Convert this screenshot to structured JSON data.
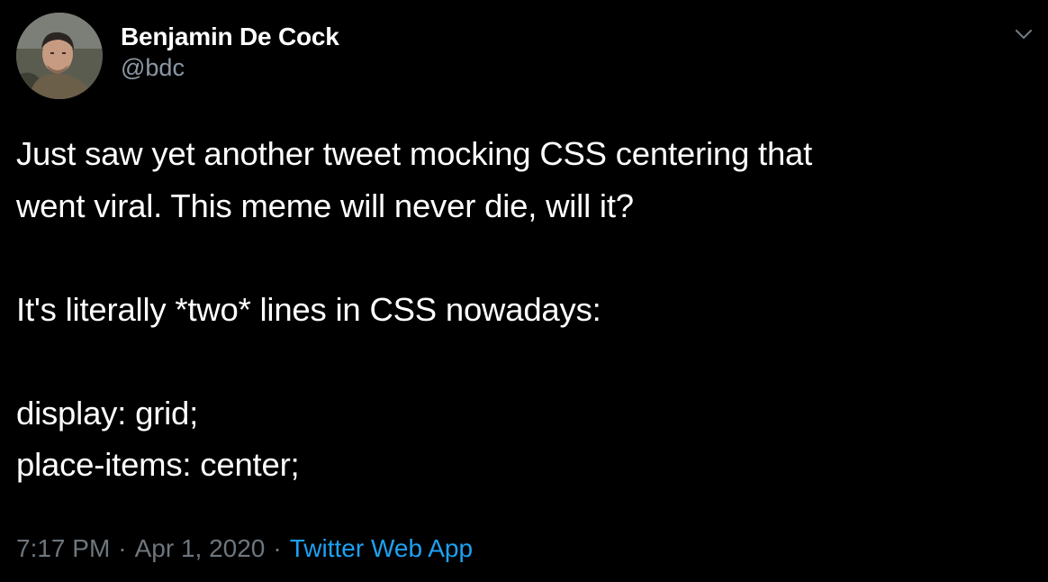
{
  "author": {
    "name": "Benjamin De Cock",
    "handle": "@bdc"
  },
  "tweet": {
    "lines": [
      "Just saw yet another tweet mocking CSS centering that",
      "went viral. This meme will never die, will it?",
      "",
      "It's literally *two* lines in CSS nowadays:",
      "",
      "display: grid;",
      "place-items: center;"
    ]
  },
  "meta": {
    "time": "7:17 PM",
    "separator": "·",
    "date": "Apr 1, 2020",
    "source": "Twitter Web App"
  },
  "icons": {
    "menu": "chevron-down-icon",
    "avatar": "profile-photo"
  },
  "colors": {
    "background": "#000000",
    "text": "#ffffff",
    "secondary": "#6e767d",
    "handle": "#8b98a5",
    "link": "#1da1f2"
  }
}
